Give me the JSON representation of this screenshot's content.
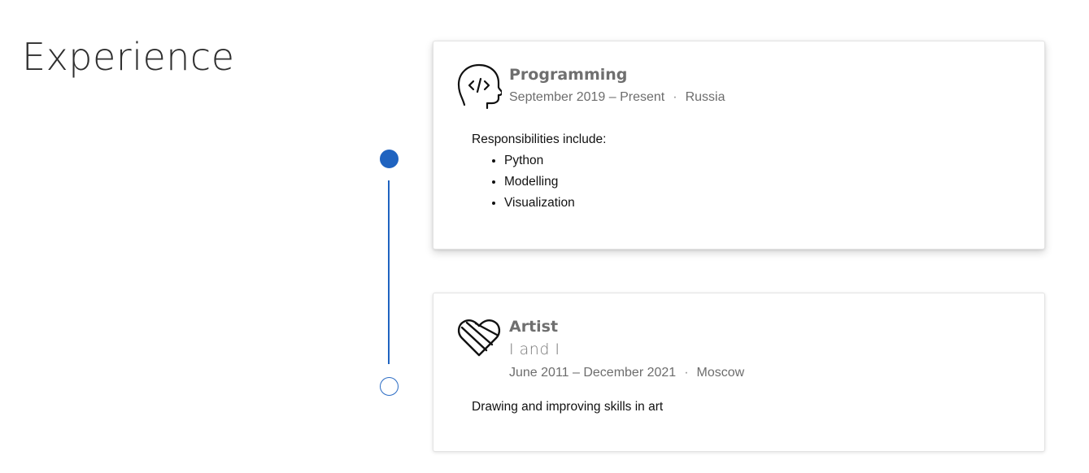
{
  "section": {
    "title": "Experience"
  },
  "timeline": {
    "accent_color": "#1f63c0"
  },
  "experiences": [
    {
      "icon": "code-head-icon",
      "title": "Programming",
      "date_range": "September 2019 – Present",
      "separator": "·",
      "location": "Russia",
      "description": "Responsibilities include:",
      "items": [
        "Python",
        "Modelling",
        "Visualization"
      ]
    },
    {
      "icon": "heart-icon",
      "title": "Artist",
      "subtitle": "I and I",
      "date_range": "June 2011 – December 2021",
      "separator": "·",
      "location": "Moscow",
      "description": "Drawing and improving skills in art"
    }
  ]
}
